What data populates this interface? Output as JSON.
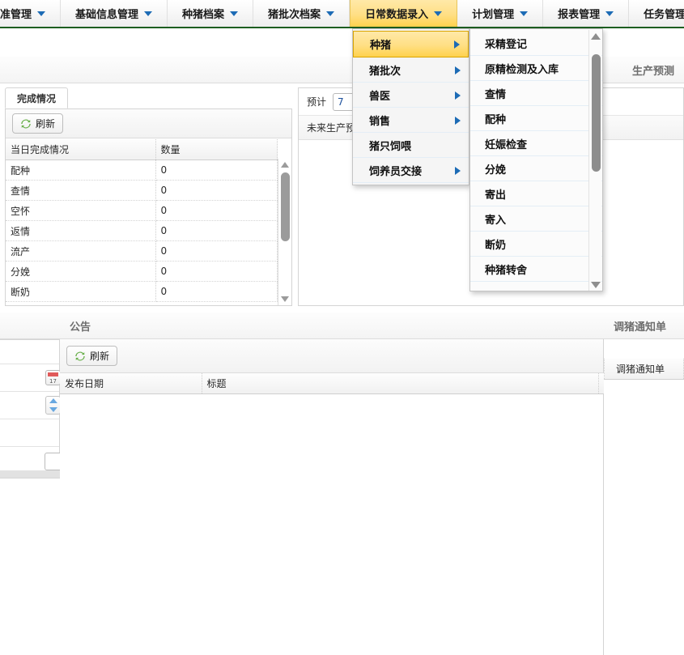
{
  "menubar": {
    "items": [
      {
        "label": "准管理",
        "has_caret": true,
        "active": false,
        "clipped_left": true
      },
      {
        "label": "基础信息管理",
        "has_caret": true,
        "active": false
      },
      {
        "label": "种猪档案",
        "has_caret": true,
        "active": false
      },
      {
        "label": "猪批次档案",
        "has_caret": true,
        "active": false
      },
      {
        "label": "日常数据录入",
        "has_caret": true,
        "active": true
      },
      {
        "label": "计划管理",
        "has_caret": true,
        "active": false
      },
      {
        "label": "报表管理",
        "has_caret": true,
        "active": false
      },
      {
        "label": "任务管理",
        "has_caret": false,
        "active": false,
        "clipped_right": true
      }
    ]
  },
  "menu_level1": {
    "items": [
      {
        "label": "种猪",
        "submenu": true,
        "highlight": true
      },
      {
        "label": "猪批次",
        "submenu": true,
        "highlight": false
      },
      {
        "label": "兽医",
        "submenu": true,
        "highlight": false
      },
      {
        "label": "销售",
        "submenu": true,
        "highlight": false
      },
      {
        "label": "猪只饲喂",
        "submenu": false,
        "highlight": false
      },
      {
        "label": "饲养员交接",
        "submenu": true,
        "highlight": false
      }
    ]
  },
  "menu_level2": {
    "items": [
      {
        "label": "采精登记"
      },
      {
        "label": "原精检测及入库"
      },
      {
        "label": "查情"
      },
      {
        "label": "配种"
      },
      {
        "label": "妊娠检查"
      },
      {
        "label": "分娩"
      },
      {
        "label": "寄出"
      },
      {
        "label": "寄入"
      },
      {
        "label": "断奶"
      },
      {
        "label": "种猪转舍"
      }
    ],
    "scrollbar": {
      "up_icon": "scroll-up-arrow",
      "down_icon": "scroll-down-arrow"
    }
  },
  "forecast_panel": {
    "header_title": "生产预测",
    "label": "预计",
    "days_value": "7",
    "note": "未来生产预"
  },
  "completion_panel": {
    "tab_label": "完成情况",
    "refresh_label": "刷新",
    "refresh_icon": "refresh-icon",
    "columns": [
      "当日完成情况",
      "数量"
    ],
    "rows": [
      {
        "name": "配种",
        "qty": "0"
      },
      {
        "name": "查情",
        "qty": "0"
      },
      {
        "name": "空怀",
        "qty": "0"
      },
      {
        "name": "返情",
        "qty": "0"
      },
      {
        "name": "流产",
        "qty": "0"
      },
      {
        "name": "分娩",
        "qty": "0"
      },
      {
        "name": "断奶",
        "qty": "0"
      }
    ]
  },
  "announcement_panel": {
    "header_title": "公告",
    "refresh_label": "刷新",
    "refresh_icon": "refresh-icon",
    "columns": [
      "发布日期",
      "标题"
    ],
    "rows": []
  },
  "transfer_panel": {
    "header_title": "调猪通知单",
    "column_label": "调猪通知单"
  },
  "left_widgets": {
    "calendar_icon": "calendar-icon",
    "spinner_icon": "number-spinner-icon",
    "text_input_value": ""
  },
  "colors": {
    "accent_green": "#1d5e20",
    "highlight_gold": "#ffd24d",
    "caret_blue": "#1c6bb5",
    "panel_border": "#d4d4d4"
  }
}
